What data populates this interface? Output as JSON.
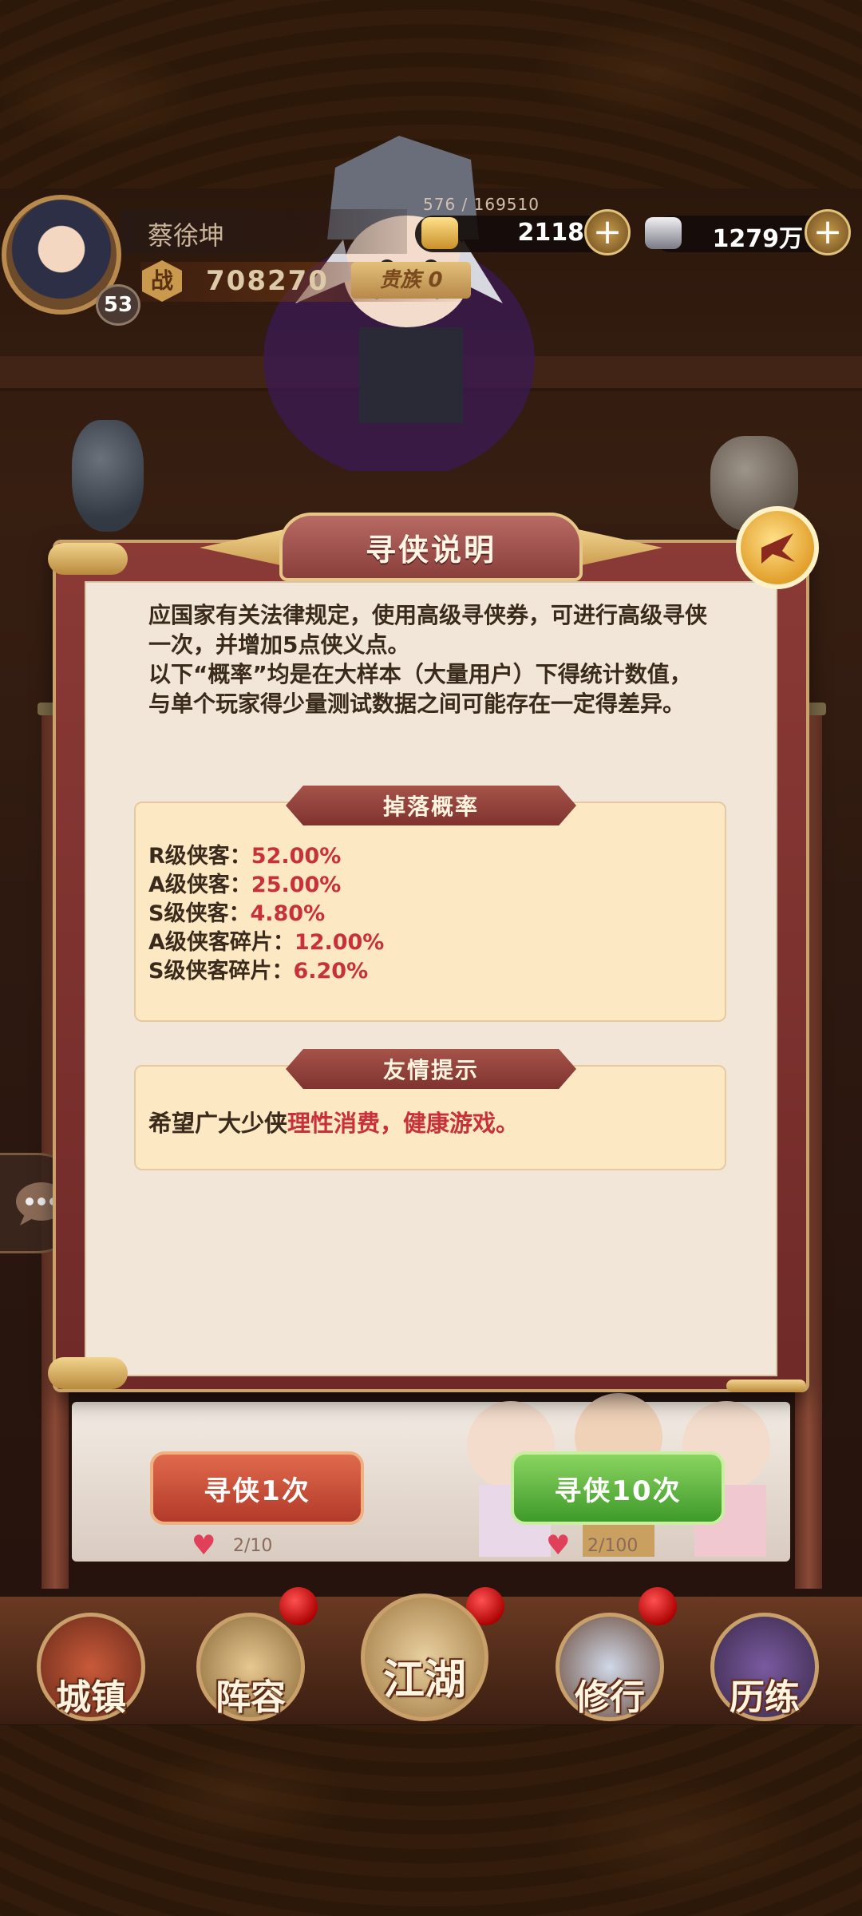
{
  "player": {
    "name": "蔡徐坤",
    "level": "53",
    "exp": "576 / 169510",
    "power_glyph": "战",
    "power": "708270",
    "vip": "贵族 0"
  },
  "currencies": [
    {
      "icon": "gold-ingot-icon",
      "value": "2118"
    },
    {
      "icon": "silver-ingot-icon",
      "value": "1279万"
    }
  ],
  "modal": {
    "title": "寻侠说明",
    "intro": [
      "应国家有关法律规定，使用高级寻侠券，可进行高级寻侠一次，并增加5点侠义点。",
      "以下“概率”均是在大样本（大量用户）下得统计数值，与单个玩家得少量测试数据之间可能存在一定得差异。"
    ],
    "drop_section_title": "掉落概率",
    "rates": [
      {
        "label": "R级侠客：",
        "value": "52.00%"
      },
      {
        "label": "A级侠客：",
        "value": "25.00%"
      },
      {
        "label": "S级侠客：",
        "value": "4.80%"
      },
      {
        "label": "A级侠客碎片：",
        "value": "12.00%"
      },
      {
        "label": "S级侠客碎片：",
        "value": "6.20%"
      }
    ],
    "tip_section_title": "友情提示",
    "tip_prefix": "希望广大少侠",
    "tip_highlight": "理性消费，健康游戏。"
  },
  "summon": {
    "single_label": "寻侠1次",
    "single_count": "2/10",
    "ten_label": "寻侠10次",
    "ten_count": "2/100"
  },
  "nav": [
    {
      "label": "城镇"
    },
    {
      "label": "阵容"
    },
    {
      "label": "江湖"
    },
    {
      "label": "修行"
    },
    {
      "label": "历练"
    }
  ],
  "colors": {
    "highlight_red": "#c8303a",
    "modal_frame": "#8b3a36",
    "panel_bg": "#f1e6d7",
    "section_bg": "#fde8c4"
  }
}
